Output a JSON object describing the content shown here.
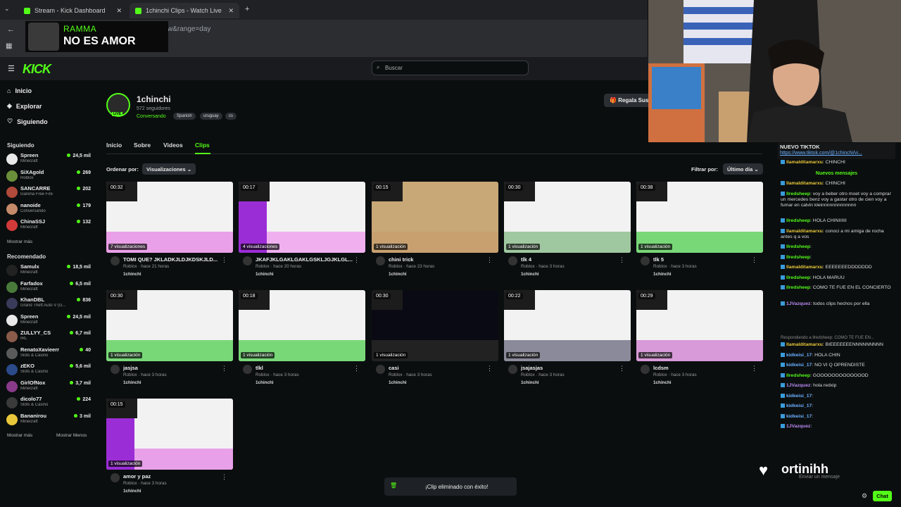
{
  "browser": {
    "tabs": [
      {
        "label": "Stream - Kick Dashboard"
      },
      {
        "label": "1chinchi Clips - Watch Live"
      }
    ],
    "url_fragment": "w&range=day"
  },
  "overlay": {
    "artist": "RAMMA",
    "song": "NO ES AMOR"
  },
  "header": {
    "logo": "KICK",
    "search_placeholder": "Buscar"
  },
  "sidebar": {
    "nav": [
      {
        "label": "Inicio"
      },
      {
        "label": "Explorar"
      },
      {
        "label": "Siguiendo"
      }
    ],
    "following_title": "Siguiendo",
    "following": [
      {
        "name": "Spreen",
        "game": "Minecraft",
        "viewers": "24,5 mil",
        "color": "#e8e8e8"
      },
      {
        "name": "SiXAgold",
        "game": "Roblox",
        "viewers": "269",
        "color": "#6a8f3a"
      },
      {
        "name": "SANCARRE",
        "game": "Garena Free Fire",
        "viewers": "202",
        "color": "#b04a3a"
      },
      {
        "name": "nanoide",
        "game": "Conversando",
        "viewers": "179",
        "color": "#c48a6a"
      },
      {
        "name": "ChinaSSJ",
        "game": "Minecraft",
        "viewers": "132",
        "color": "#d23a3a"
      }
    ],
    "show_more": "Mostrar más",
    "recommended_title": "Recomendado",
    "recommended": [
      {
        "name": "Samulx",
        "game": "Minecraft",
        "viewers": "18,5 mil",
        "color": "#222"
      },
      {
        "name": "Farfadox",
        "game": "Minecraft",
        "viewers": "6,5 mil",
        "color": "#4a7a3a"
      },
      {
        "name": "KhanDBL",
        "game": "Grand Theft Auto V (G...",
        "viewers": "836",
        "color": "#3a3a5a"
      },
      {
        "name": "Spreen",
        "game": "Minecraft",
        "viewers": "24,5 mil",
        "color": "#e8e8e8"
      },
      {
        "name": "ZULLYY_CS",
        "game": "IRL",
        "viewers": "6,7 mil",
        "color": "#8a5a4a"
      },
      {
        "name": "RenatoXavieerr",
        "game": "Slots & Casino",
        "viewers": "40",
        "color": "#5a5a5a"
      },
      {
        "name": "zEKO",
        "game": "Slots & Casino",
        "viewers": "5,6 mil",
        "color": "#2a4a8a"
      },
      {
        "name": "GirlOfNox",
        "game": "Minecraft",
        "viewers": "3,7 mil",
        "color": "#8a3a8a"
      },
      {
        "name": "dicolo77",
        "game": "Slots & Casino",
        "viewers": "224",
        "color": "#3a3a3a"
      },
      {
        "name": "Bananirou",
        "game": "Minecraft",
        "viewers": "3 mil",
        "color": "#e8c83a"
      }
    ],
    "show_more_2": "Mostrar más",
    "show_less": "Mostrar Menos"
  },
  "channel": {
    "name": "1chinchi",
    "followers": "572 seguidores",
    "category": "Conversando",
    "tags": [
      "Spanish",
      "uruguay",
      "cs"
    ],
    "live": "LIVE",
    "sub_button": "Regala Sus",
    "tabs": [
      "Inicio",
      "Sobre",
      "Videos",
      "Clips"
    ]
  },
  "controls": {
    "sort_label": "Ordenar por:",
    "sort_value": "Visualizaciones",
    "filter_label": "Filtrar por:",
    "filter_value": "Último día"
  },
  "clips": [
    {
      "title": "TOMI QUE? JKLADKJLDJKDSKJLD...",
      "duration": "00:32",
      "views": "7 visualizaciones",
      "meta": "Roblox · hace 21 horas",
      "channel": "1chinchi"
    },
    {
      "title": "JKAFJKLGAKLGAKLGSKLJGJKLGL...",
      "duration": "00:17",
      "views": "4 visualizaciones",
      "meta": "Roblox · hace 20 horas",
      "channel": "1chinchi"
    },
    {
      "title": "chini trick",
      "duration": "00:15",
      "views": "1 visualización",
      "meta": "Roblox · hace 23 horas",
      "channel": "1chinchi"
    },
    {
      "title": "tlk 4",
      "duration": "00:30",
      "views": "1 visualización",
      "meta": "Roblox · hace 3 horas",
      "channel": "1chinchi"
    },
    {
      "title": "tlk 5",
      "duration": "00:38",
      "views": "1 visualización",
      "meta": "Roblox · hace 3 horas",
      "channel": "1chinchi"
    },
    {
      "title": "jasjsa",
      "duration": "00:30",
      "views": "1 visualización",
      "meta": "Roblox · hace 3 horas",
      "channel": "1chinchi"
    },
    {
      "title": "tlkl",
      "duration": "00:18",
      "views": "1 visualización",
      "meta": "Roblox · hace 3 horas",
      "channel": "1chinchi"
    },
    {
      "title": "casi",
      "duration": "00:30",
      "views": "1 visualización",
      "meta": "Roblox · hace 3 horas",
      "channel": "1chinchi"
    },
    {
      "title": "jsajasjas",
      "duration": "00:22",
      "views": "1 visualización",
      "meta": "Roblox · hace 3 horas",
      "channel": "1chinchi"
    },
    {
      "title": "lcdsm",
      "duration": "00:29",
      "views": "1 visualización",
      "meta": "Roblox · hace 3 horas",
      "channel": "1chinchi"
    },
    {
      "title": "amor y paz",
      "duration": "00:15",
      "views": "1 visualización",
      "meta": "Roblox · hace 3 horas",
      "channel": "1chinchi"
    }
  ],
  "toast": "¡Clip eliminado con éxito!",
  "chat": {
    "pinned_title": "NUEVO TIKTOK",
    "pinned_link": "https://www.tiktok.com/@1chinchi/vi...",
    "new_messages": "Nuevos mensajes",
    "messages": [
      {
        "user": "llamalditamarxu",
        "text": "CHINCHI",
        "color": "#e8c83a"
      },
      {
        "user": "llamalditamarxu",
        "text": "CHINCHI",
        "color": "#e8c83a"
      },
      {
        "user": "llredsheep",
        "text": "voy a beber otro moet voy a comprar un mercedes benz voy a gastar otro de cien voy a fumar en calvin kleinnnnnnnnnnnnn",
        "color": "#53fc18"
      },
      {
        "user": "llredsheep",
        "text": "HOLA CHINIIIIII",
        "color": "#53fc18"
      },
      {
        "user": "llamalditamarxu",
        "text": "conoci a mi amiga de rocha antes q a vos",
        "color": "#e8c83a"
      },
      {
        "user": "llredsheep",
        "text": "",
        "color": "#53fc18"
      },
      {
        "user": "llredsheep",
        "text": "",
        "color": "#53fc18"
      },
      {
        "user": "llamalditamarxu",
        "text": "EEEEEEEDDDDDDD",
        "color": "#e8c83a"
      },
      {
        "user": "llredsheep",
        "text": "HOLA MARUU",
        "color": "#53fc18"
      },
      {
        "user": "llredsheep",
        "text": "COMO TE FUE EN EL CONCIERTO",
        "color": "#53fc18"
      },
      {
        "user": "1JVazquez",
        "text": "todos clips hechos por ella",
        "color": "#b98af0"
      },
      {
        "user": "llamalditamarxu",
        "text": "BIEEEEEEENNNNNNNNN",
        "color": "#e8c83a"
      },
      {
        "user": "kidkeisi_17",
        "text": "HOLA CHIN",
        "color": "#6ab0ff"
      },
      {
        "user": "kidkeisi_17",
        "text": "NO VI Q OPRENDISTE",
        "color": "#6ab0ff"
      },
      {
        "user": "llredsheep",
        "text": "GOOOOOOOOOOOOOD",
        "color": "#53fc18"
      },
      {
        "user": "1JVazquez",
        "text": "hola redxip",
        "color": "#b98af0"
      },
      {
        "user": "kidkeisi_17",
        "text": "",
        "color": "#6ab0ff"
      },
      {
        "user": "kidkeisi_17",
        "text": "",
        "color": "#6ab0ff"
      },
      {
        "user": "kidkeisi_17",
        "text": "",
        "color": "#6ab0ff"
      },
      {
        "user": "1JVazquez",
        "text": "",
        "color": "#b98af0"
      }
    ],
    "reply_note": "Respondiendo a llredsheep: COMO TE FUE EN...",
    "input_placeholder": "Enviar un mensaje",
    "send_label": "Chat"
  },
  "overlay_name": "ortinihh"
}
